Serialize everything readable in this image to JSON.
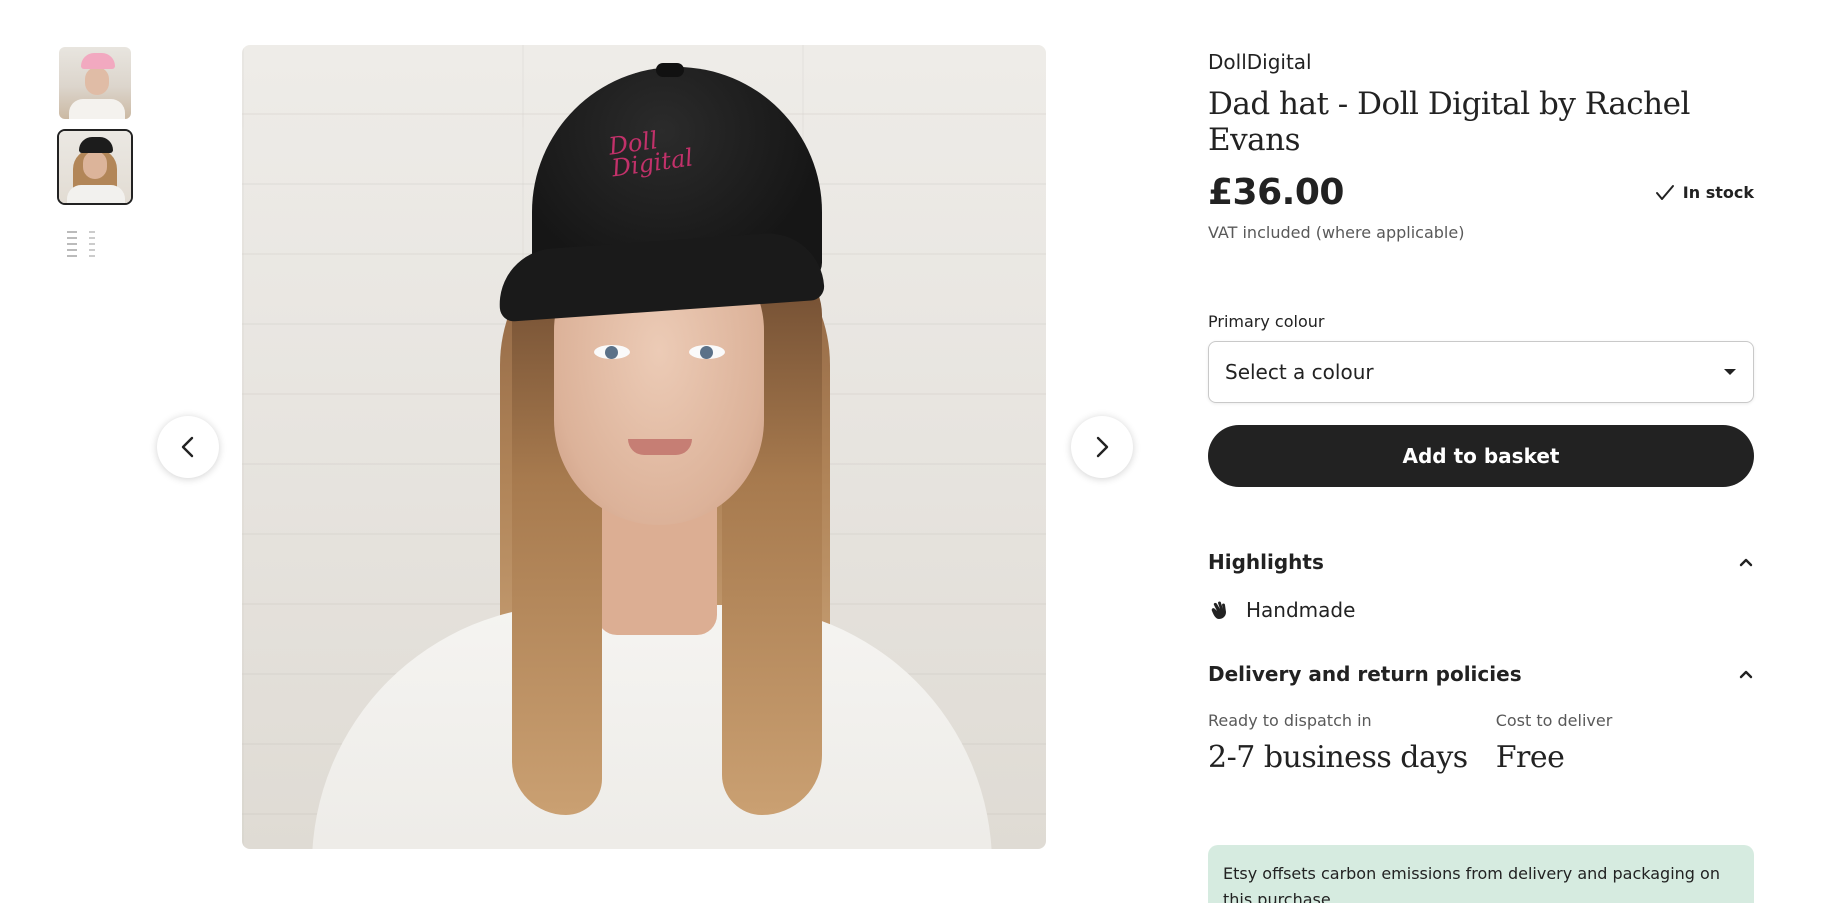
{
  "gallery": {
    "thumbnails": [
      {
        "name": "pink-cap-photo",
        "active": false
      },
      {
        "name": "black-cap-photo",
        "active": true
      },
      {
        "name": "size-chart",
        "active": false
      }
    ],
    "embroidery_line1": "Doll",
    "embroidery_line2": "Digital",
    "prev_icon": "chevron-left-icon",
    "next_icon": "chevron-right-icon"
  },
  "product": {
    "shop_name": "DollDigital",
    "title": "Dad hat - Doll Digital by Rachel Evans",
    "price": "£36.00",
    "stock_status": "In stock",
    "vat_note": "VAT included (where applicable)"
  },
  "options": {
    "primary_colour_label": "Primary colour",
    "primary_colour_value": "Select a colour"
  },
  "actions": {
    "add_to_basket": "Add to basket"
  },
  "highlights": {
    "heading": "Highlights",
    "items": [
      {
        "icon": "handmade-hand-icon",
        "label": "Handmade"
      }
    ]
  },
  "delivery": {
    "heading": "Delivery and return policies",
    "dispatch_label": "Ready to dispatch in",
    "dispatch_value": "2-7 business days",
    "cost_label": "Cost to deliver",
    "cost_value": "Free"
  },
  "notice": {
    "carbon_text": "Etsy offsets carbon emissions from delivery and packaging on this purchase."
  },
  "colors": {
    "primary_button": "#222222",
    "notice_bg": "#d6ebe0",
    "embroidery": "#c2316a"
  }
}
